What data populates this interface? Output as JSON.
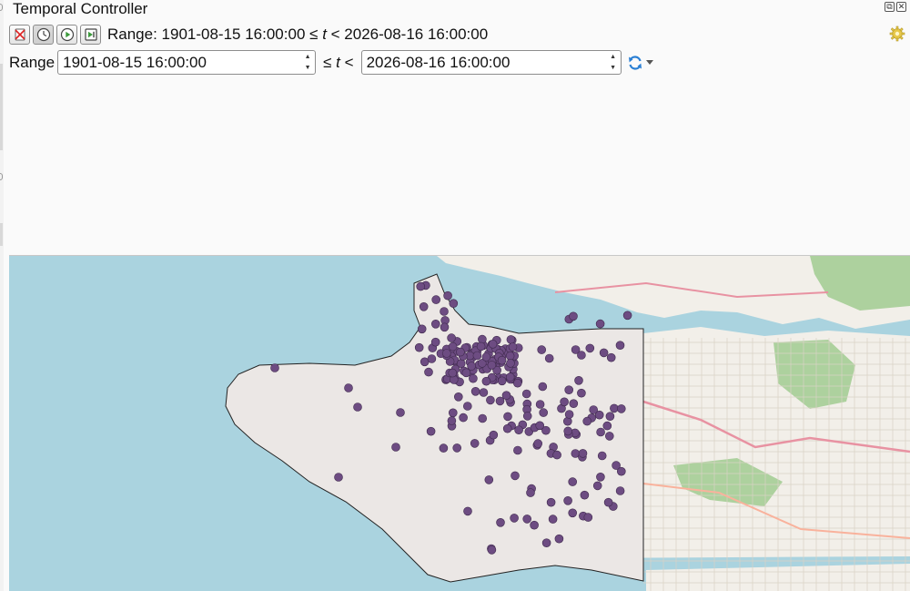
{
  "panel": {
    "title": "Temporal Controller"
  },
  "window_buttons": [
    {
      "name": "float-icon",
      "glyph": "⧉"
    },
    {
      "name": "close-icon",
      "glyph": "✕"
    }
  ],
  "toolbar": {
    "buttons": [
      {
        "name": "temporal-navigation-off-button",
        "icon": "crossed-out-icon"
      },
      {
        "name": "fixed-range-button",
        "icon": "clock-icon"
      },
      {
        "name": "animated-navigation-button",
        "icon": "play-icon"
      },
      {
        "name": "movie-navigation-button",
        "icon": "step-forward-icon"
      }
    ],
    "summary_prefix": "Range: 1901-08-15 16:00:00 ≤ ",
    "summary_var": "t",
    "summary_suffix": " < 2026-08-16 16:00:00",
    "settings_icon": "gear-icon"
  },
  "range_row": {
    "label": "Range",
    "start": "1901-08-15 16:00:00",
    "operator_prefix": "≤ ",
    "operator_var": "t",
    "operator_suffix": " <",
    "end": "2026-08-16 16:00:00",
    "refresh_icon": "refresh-icon",
    "menu_icon": "chevron-down-icon"
  },
  "map": {
    "layer_point_color": "#6d4c82",
    "water_color": "#aad3df",
    "land_color": "#f2efe9",
    "polygon_fill": "#ebe7e5",
    "park_color": "#add19e"
  }
}
